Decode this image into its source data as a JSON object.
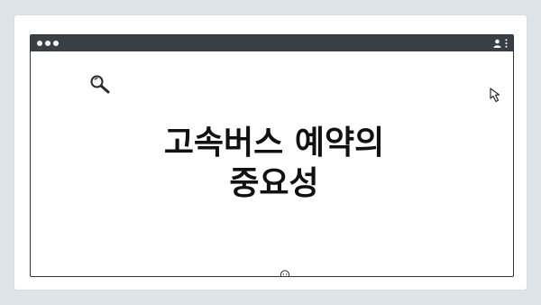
{
  "window": {
    "controls": [
      "close",
      "minimize",
      "maximize"
    ],
    "icons": {
      "user": "user-icon",
      "menu": "kebab-menu-icon",
      "search": "search-icon",
      "cursor": "cursor-arrow-icon",
      "smiley": "lightbulb-face-icon"
    }
  },
  "content": {
    "title_line1": "고속버스 예약의",
    "title_line2": "중요성"
  },
  "colors": {
    "background": "#dfe4ea",
    "titlebar": "#3a3f44",
    "text": "#111111",
    "window": "#ffffff"
  }
}
